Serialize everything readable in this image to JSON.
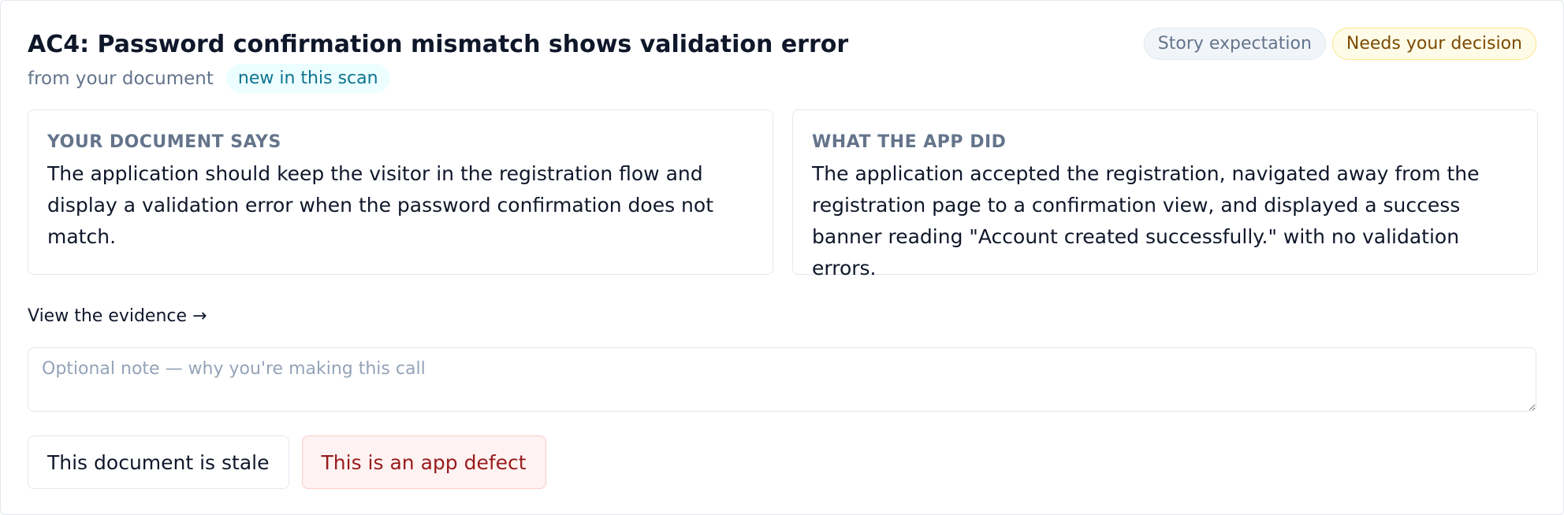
{
  "finding": {
    "title": "AC4: Password confirmation mismatch shows validation error",
    "source": "from your document",
    "scan_tag": "new in this scan"
  },
  "badges": {
    "type": "Story expectation",
    "status": "Needs your decision"
  },
  "document": {
    "label": "YOUR DOCUMENT SAYS",
    "text": "The application should keep the visitor in the registration flow and display a validation error when the password confirmation does not match."
  },
  "app": {
    "label": "WHAT THE APP DID",
    "text": "The application accepted the registration, navigated away from the registration page to a confirmation view, and displayed a success banner reading \"Account created successfully.\" with no validation errors."
  },
  "evidence_link": "View the evidence →",
  "note": {
    "value": "",
    "placeholder": "Optional note — why you're making this call"
  },
  "actions": {
    "stale_label": "This document is stale",
    "defect_label": "This is an app defect"
  },
  "colors": {
    "defect_accent": "#991b1b",
    "status_accent": "#7c4a03",
    "scan_tag_accent": "#0e7490"
  }
}
